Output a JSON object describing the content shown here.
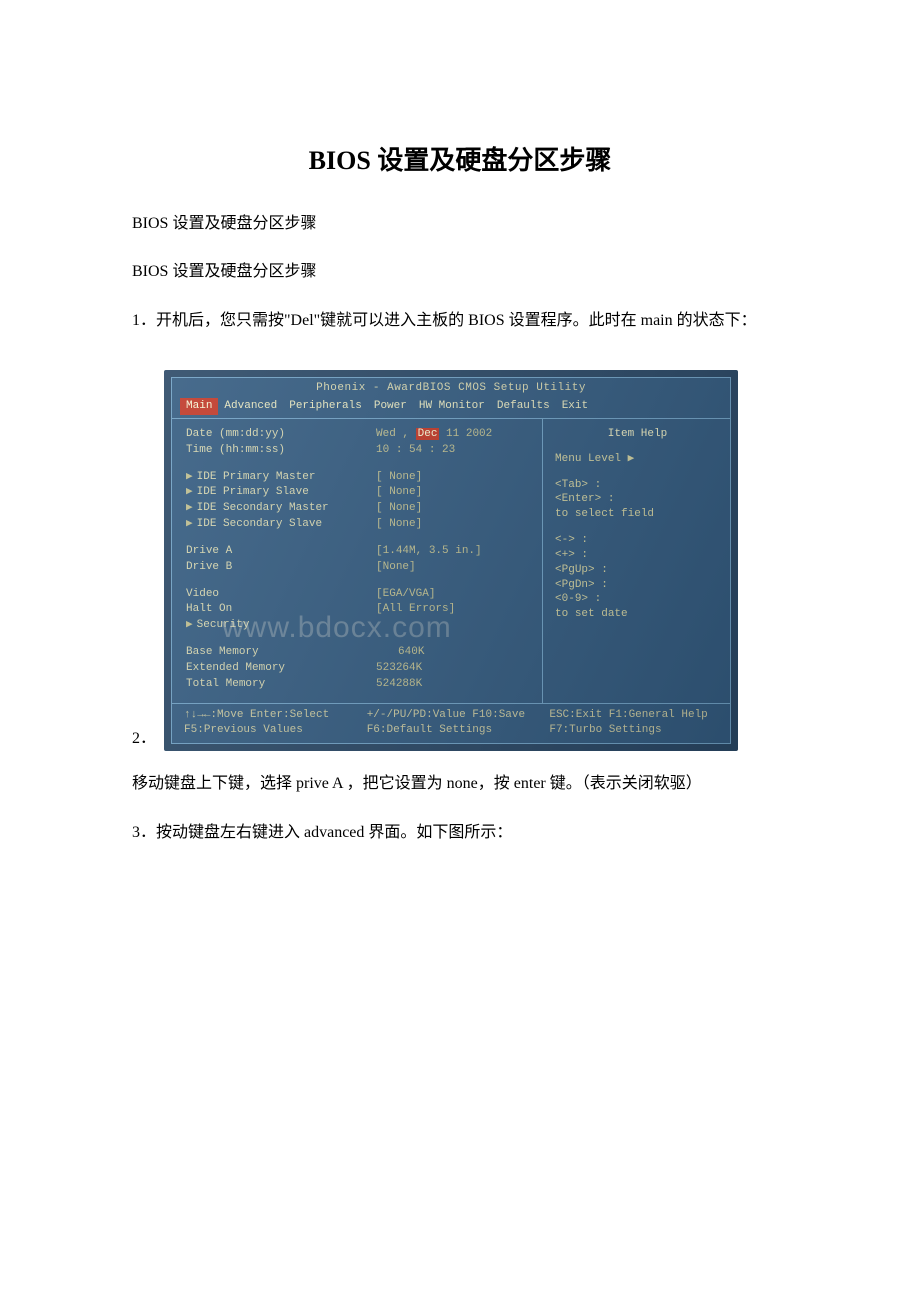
{
  "doc": {
    "title": "BIOS 设置及硬盘分区步骤",
    "p1": "BIOS 设置及硬盘分区步骤",
    "p2": "BIOS 设置及硬盘分区步骤",
    "p3": "1．开机后，您只需按\"Del\"键就可以进入主板的 BIOS 设置程序。此时在 main 的状态下：",
    "marker2": "2．",
    "p4": "移动键盘上下键，选择 prive A ，把它设置为 none，按 enter 键。（表示关闭软驱）",
    "p5": "3．按动键盘左右键进入 advanced 界面。如下图所示："
  },
  "bios": {
    "topTitle": "Phoenix - AwardBIOS CMOS Setup Utility",
    "menu": [
      "Main",
      "Advanced",
      "Peripherals",
      "Power",
      "HW Monitor",
      "Defaults",
      "Exit"
    ],
    "activeMenu": "Main",
    "fields": {
      "dateLabel": "Date (mm:dd:yy)",
      "dateValPre": "Wed , ",
      "dateValHl": "Dec",
      "dateValPost": " 11 2002",
      "timeLabel": "Time (hh:mm:ss)",
      "timeVal": "10 : 54 : 23",
      "idePM": "IDE Primary Master",
      "idePS": "IDE Primary Slave",
      "ideSM": "IDE Secondary Master",
      "ideSS": "IDE Secondary Slave",
      "none": "[ None]",
      "driveA": "Drive A",
      "driveAVal": "[1.44M, 3.5 in.]",
      "driveB": "Drive B",
      "driveBVal": "[None]",
      "video": "Video",
      "videoVal": "[EGA/VGA]",
      "haltOn": "Halt On",
      "haltOnVal": "[All Errors]",
      "security": "Security",
      "baseMem": "Base Memory",
      "baseMemVal": "640K",
      "extMem": "Extended Memory",
      "extMemVal": "523264K",
      "totMem": "Total Memory",
      "totMemVal": "524288K"
    },
    "help": {
      "title": "Item Help",
      "menuLevel": "Menu Level   ▶",
      "l1": "<Tab>  :",
      "l2": "<Enter> :",
      "l3": "   to select field",
      "l4": "<->  :",
      "l5": "<+>  :",
      "l6": "<PgUp> :",
      "l7": "<PgDn> :",
      "l8": "<0-9> :",
      "l9": "   to set date"
    },
    "footer": {
      "a1": "↑↓→←:Move  Enter:Select",
      "a2": "F5:Previous Values",
      "b1": "+/-/PU/PD:Value  F10:Save",
      "b2": "F6:Default Settings",
      "c1": "ESC:Exit  F1:General Help",
      "c2": "F7:Turbo Settings"
    },
    "watermark": "www.bdocx.com"
  }
}
